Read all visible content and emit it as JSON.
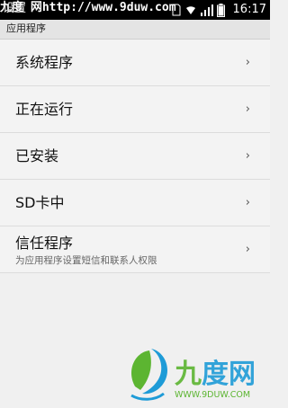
{
  "status_bar": {
    "title": "设置",
    "watermark": "九度 网http://www.9duw.com",
    "time": "16:17",
    "icons": [
      "sim-icon",
      "wifi-icon",
      "signal-icon",
      "battery-icon"
    ]
  },
  "section": {
    "header": "应用程序"
  },
  "items": [
    {
      "label": "系统程序"
    },
    {
      "label": "正在运行"
    },
    {
      "label": "已安装"
    },
    {
      "label": "SD卡中"
    },
    {
      "label": "信任程序",
      "sub": "为应用程序设置短信和联系人权限"
    }
  ],
  "chevron": "›",
  "logo": {
    "name": "九度网",
    "url": "WWW.9DUW.COM"
  },
  "colors": {
    "status_bar": "#000000",
    "background": "#f0f0f0",
    "logo_blue": "#1e9bd7",
    "logo_green": "#5cb531"
  }
}
